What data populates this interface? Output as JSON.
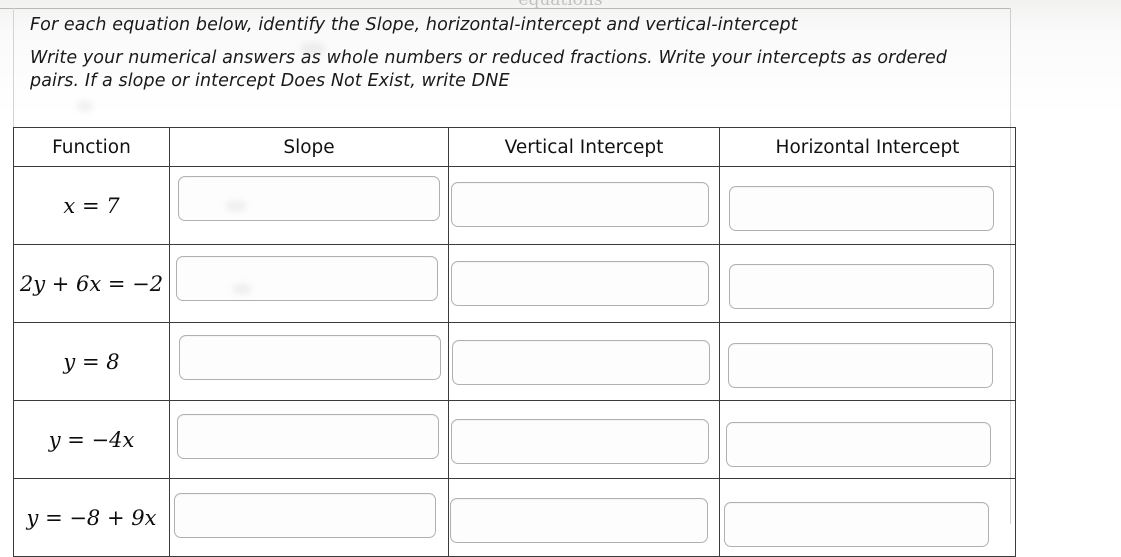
{
  "document": {
    "top_cropped_text": "equations",
    "instructions": {
      "line1": "For each equation below, identify the Slope, horizontal-intercept and vertical-intercept",
      "line2": "Write your numerical answers as whole numbers or reduced fractions. Write your intercepts as ordered pairs. If a slope or intercept Does Not Exist, write DNE"
    },
    "table": {
      "headers": [
        "Function",
        "Slope",
        "Vertical Intercept",
        "Horizontal Intercept"
      ],
      "rows": [
        {
          "function": "x = 7",
          "slope_value": "",
          "slope_placeholder": "",
          "vertical_intercept_value": "",
          "vertical_intercept_placeholder": "",
          "horizontal_intercept_value": "",
          "horizontal_intercept_placeholder": ""
        },
        {
          "function": "2y + 6x = −2",
          "slope_value": "",
          "slope_placeholder": "",
          "vertical_intercept_value": "",
          "vertical_intercept_placeholder": "",
          "horizontal_intercept_value": "",
          "horizontal_intercept_placeholder": ""
        },
        {
          "function": "y = 8",
          "slope_value": "",
          "slope_placeholder": "",
          "vertical_intercept_value": "",
          "vertical_intercept_placeholder": "",
          "horizontal_intercept_value": "",
          "horizontal_intercept_placeholder": ""
        },
        {
          "function": "y = −4x",
          "slope_value": "",
          "slope_placeholder": "",
          "vertical_intercept_value": "",
          "vertical_intercept_placeholder": "",
          "horizontal_intercept_value": "",
          "horizontal_intercept_placeholder": ""
        },
        {
          "function": "y = −8 + 9x",
          "slope_value": "",
          "slope_placeholder": "",
          "vertical_intercept_value": "",
          "vertical_intercept_placeholder": "",
          "horizontal_intercept_value": "",
          "horizontal_intercept_placeholder": ""
        }
      ]
    }
  }
}
